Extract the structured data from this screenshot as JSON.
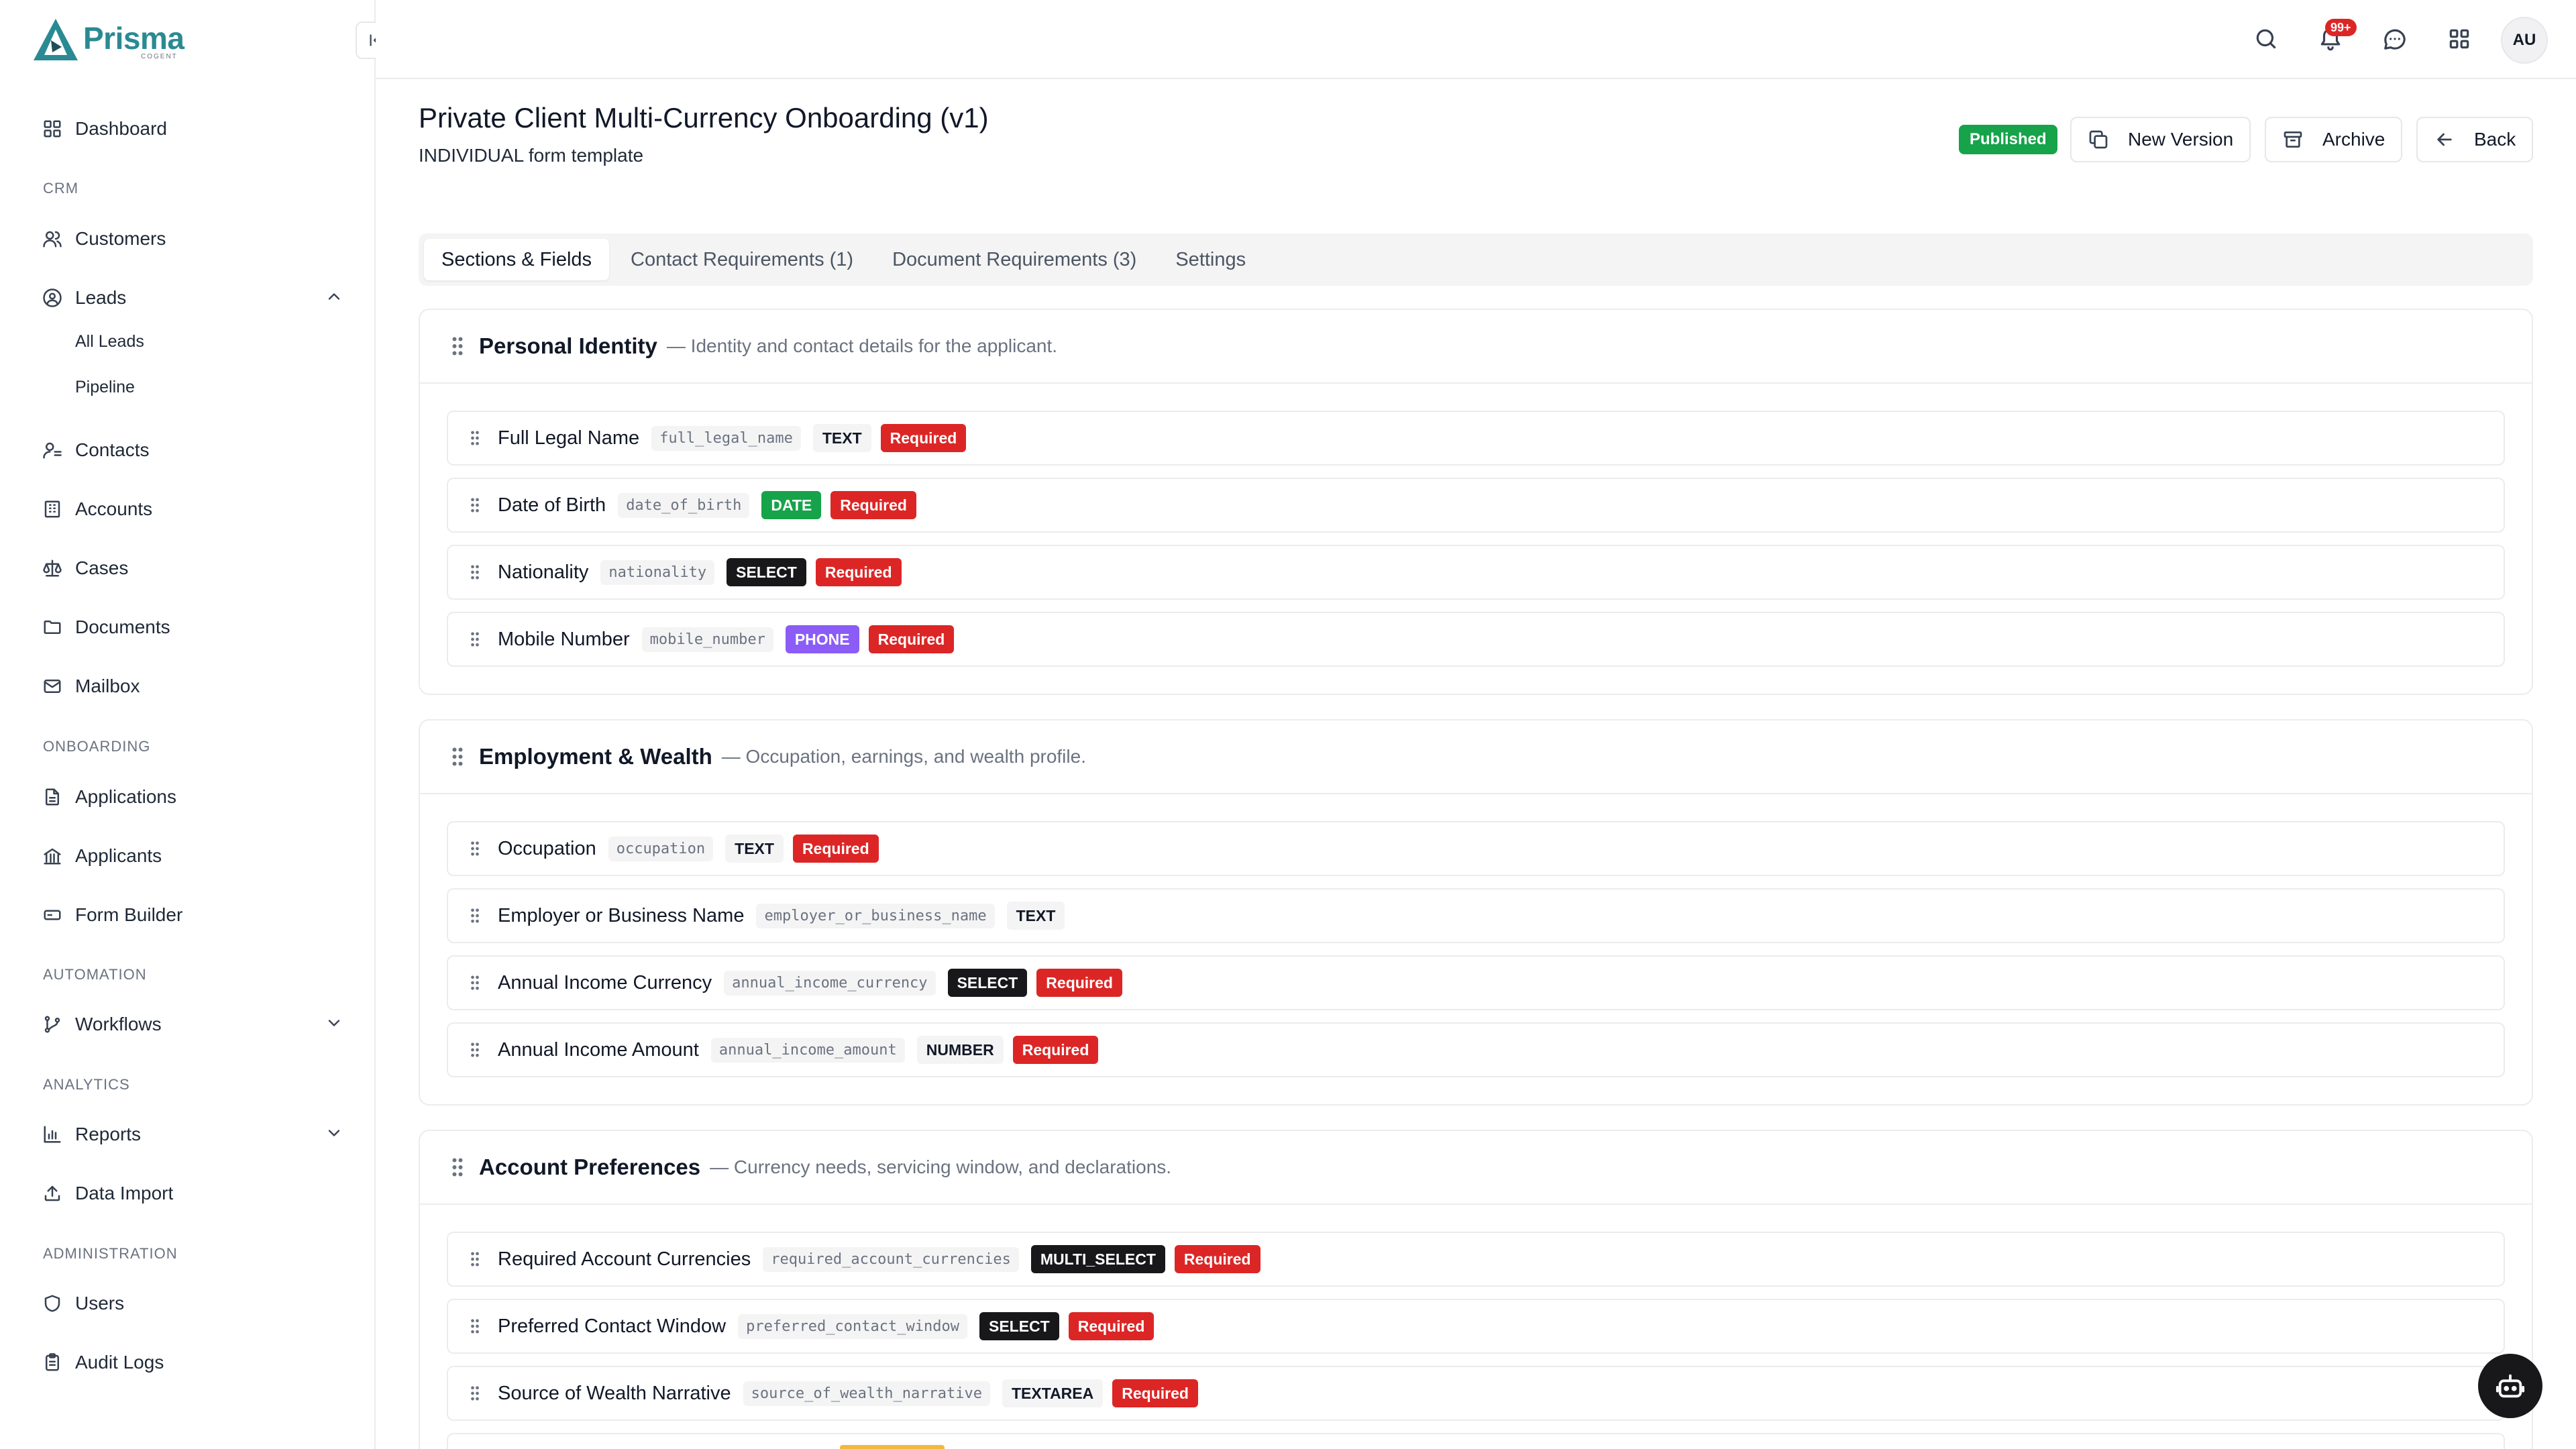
{
  "app": {
    "name": "Prisma",
    "sub": "COGENT"
  },
  "sidebar": {
    "dashboard": "Dashboard",
    "crm_label": "CRM",
    "customers": "Customers",
    "leads": "Leads",
    "all_leads": "All Leads",
    "pipeline": "Pipeline",
    "contacts": "Contacts",
    "accounts": "Accounts",
    "cases": "Cases",
    "documents": "Documents",
    "mailbox": "Mailbox",
    "onboarding_label": "ONBOARDING",
    "applications": "Applications",
    "applicants": "Applicants",
    "form_builder": "Form Builder",
    "automation_label": "AUTOMATION",
    "workflows": "Workflows",
    "analytics_label": "ANALYTICS",
    "reports": "Reports",
    "data_import": "Data Import",
    "administration_label": "ADMINISTRATION",
    "users": "Users",
    "audit_logs": "Audit Logs"
  },
  "topbar": {
    "notification_count": "99+",
    "avatar_initials": "AU"
  },
  "page": {
    "title": "Private Client Multi-Currency Onboarding (v1)",
    "subtitle": "INDIVIDUAL form template",
    "status": "Published",
    "new_version": "New Version",
    "archive": "Archive",
    "back": "Back"
  },
  "tabs": [
    "Sections & Fields",
    "Contact Requirements (1)",
    "Document Requirements (3)",
    "Settings"
  ],
  "sections": [
    {
      "title": "Personal Identity",
      "desc": "— Identity and contact details for the applicant.",
      "fields": [
        {
          "label": "Full Legal Name",
          "key": "full_legal_name",
          "type": "TEXT",
          "required": "Required"
        },
        {
          "label": "Date of Birth",
          "key": "date_of_birth",
          "type": "DATE",
          "required": "Required"
        },
        {
          "label": "Nationality",
          "key": "nationality",
          "type": "SELECT",
          "required": "Required"
        },
        {
          "label": "Mobile Number",
          "key": "mobile_number",
          "type": "PHONE",
          "required": "Required"
        }
      ]
    },
    {
      "title": "Employment & Wealth",
      "desc": "— Occupation, earnings, and wealth profile.",
      "fields": [
        {
          "label": "Occupation",
          "key": "occupation",
          "type": "TEXT",
          "required": "Required"
        },
        {
          "label": "Employer or Business Name",
          "key": "employer_or_business_name",
          "type": "TEXT",
          "required": ""
        },
        {
          "label": "Annual Income Currency",
          "key": "annual_income_currency",
          "type": "SELECT",
          "required": "Required"
        },
        {
          "label": "Annual Income Amount",
          "key": "annual_income_amount",
          "type": "NUMBER",
          "required": "Required"
        }
      ]
    },
    {
      "title": "Account Preferences",
      "desc": "— Currency needs, servicing window, and declarations.",
      "fields": [
        {
          "label": "Required Account Currencies",
          "key": "required_account_currencies",
          "type": "MULTI_SELECT",
          "required": "Required"
        },
        {
          "label": "Preferred Contact Window",
          "key": "preferred_contact_window",
          "type": "SELECT",
          "required": "Required"
        },
        {
          "label": "Source of Wealth Narrative",
          "key": "source_of_wealth_narrative",
          "type": "TEXTAREA",
          "required": "Required"
        }
      ]
    }
  ],
  "colors": {
    "brand": "#2a8a93",
    "published": "#16a34a",
    "required": "#dc2626",
    "date": "#16a34a",
    "phone": "#8b5cf6",
    "dark_badge": "#18181b"
  }
}
